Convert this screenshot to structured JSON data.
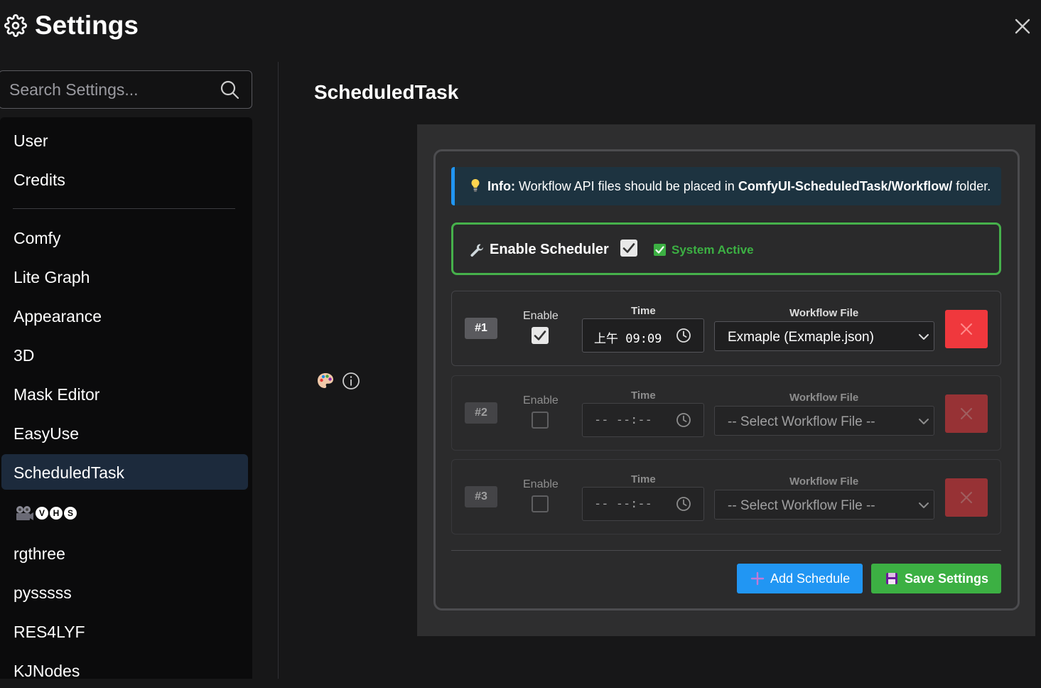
{
  "header": {
    "title": "Settings",
    "icon": "gear-icon",
    "close_icon": "close-icon"
  },
  "search": {
    "placeholder": "Search Settings...",
    "value": ""
  },
  "sidebar": {
    "items": [
      {
        "label": "User"
      },
      {
        "label": "Credits"
      },
      {
        "label": "Comfy"
      },
      {
        "label": "Lite Graph"
      },
      {
        "label": "Appearance"
      },
      {
        "label": "3D"
      },
      {
        "label": "Mask Editor"
      },
      {
        "label": "EasyUse"
      },
      {
        "label": "ScheduledTask",
        "active": true
      },
      {
        "label": "rgthree"
      },
      {
        "label": "pysssss"
      },
      {
        "label": "RES4LYF"
      },
      {
        "label": "KJNodes"
      }
    ],
    "vhs": {
      "icon": "film-camera-icon",
      "letters": [
        "V",
        "H",
        "S"
      ]
    }
  },
  "section": {
    "title": "ScheduledTask",
    "icons": [
      "palette-icon",
      "info-icon"
    ]
  },
  "info": {
    "label": "Info:",
    "text_before": " Workflow API files should be placed in ",
    "path": "ComfyUI-ScheduledTask/Workflow/",
    "text_after": " folder."
  },
  "scheduler": {
    "label": "Enable Scheduler",
    "enabled": true,
    "status": "System Active",
    "status_color": "#3cb043"
  },
  "schedules": [
    {
      "badge": "#1",
      "enable_label": "Enable",
      "enabled": true,
      "time_label": "Time",
      "time": "上午 09:09",
      "file_label": "Workflow File",
      "file": "Exmaple (Exmaple.json)"
    },
    {
      "badge": "#2",
      "enable_label": "Enable",
      "enabled": false,
      "time_label": "Time",
      "time": "-- --:--",
      "file_label": "Workflow File",
      "file": "-- Select Workflow File --"
    },
    {
      "badge": "#3",
      "enable_label": "Enable",
      "enabled": false,
      "time_label": "Time",
      "time": "-- --:--",
      "file_label": "Workflow File",
      "file": "-- Select Workflow File --"
    }
  ],
  "actions": {
    "add_label": "Add Schedule",
    "save_label": "Save Settings",
    "add_color": "#2196f3",
    "save_color": "#3cb043",
    "delete_color": "#f0383d"
  }
}
